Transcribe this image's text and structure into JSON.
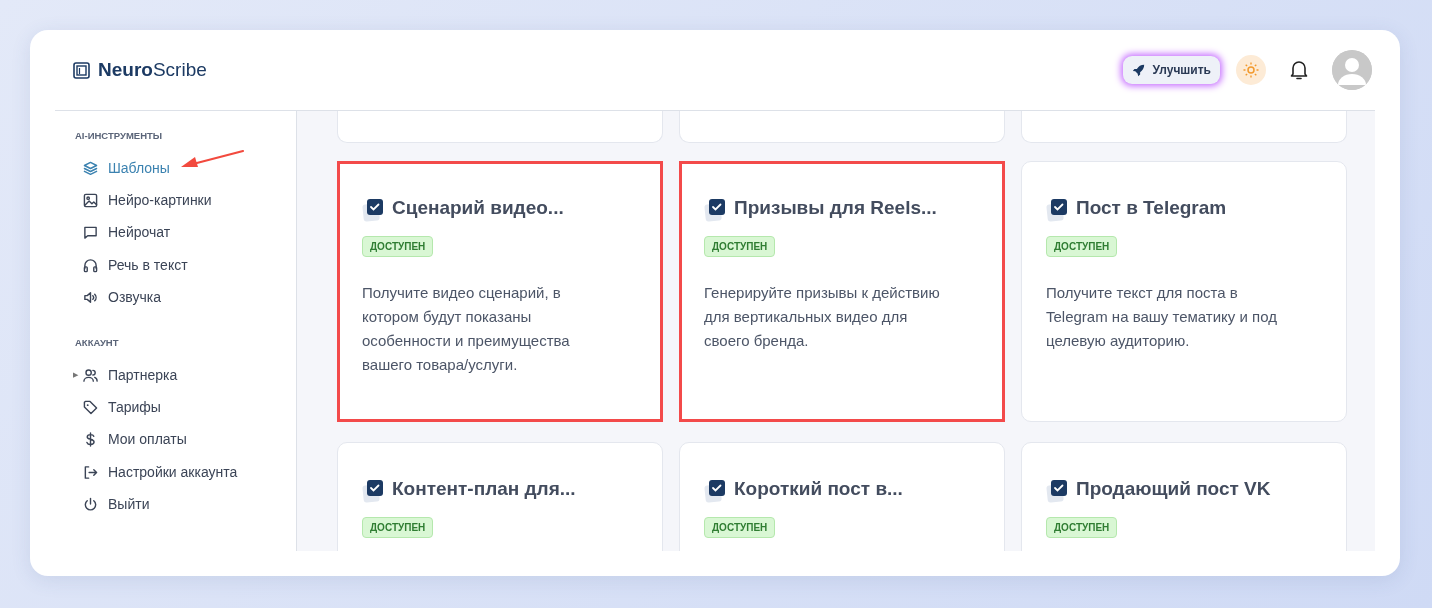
{
  "brand": {
    "bold": "Neuro",
    "light": "Scribe"
  },
  "header": {
    "upgrade_button": "Улучшить"
  },
  "sidebar": {
    "pointer_arrow": true,
    "sections": [
      {
        "title": "AI-ИНСТРУМЕНТЫ",
        "items": [
          {
            "label": "Шаблоны",
            "kind": "layers",
            "selected": true
          },
          {
            "label": "Нейро-картинки",
            "kind": "image",
            "selected": false
          },
          {
            "label": "Нейрочат",
            "kind": "chat",
            "selected": false
          },
          {
            "label": "Речь в текст",
            "kind": "headphones",
            "selected": false
          },
          {
            "label": "Озвучка",
            "kind": "speaker",
            "selected": false
          }
        ]
      },
      {
        "title": "АККАУНТ",
        "items": [
          {
            "label": "Партнерка",
            "kind": "users",
            "selected": false,
            "expand_marker": "▶"
          },
          {
            "label": "Тарифы",
            "kind": "tag",
            "selected": false
          },
          {
            "label": "Мои оплаты",
            "kind": "dollar",
            "selected": false
          },
          {
            "label": "Настройки аккаунта",
            "kind": "exit",
            "selected": false
          },
          {
            "label": "Выйти",
            "kind": "power",
            "selected": false
          }
        ]
      }
    ]
  },
  "cards": [
    {
      "title": "Сценарий видео...",
      "badge": "ДОСТУПЕН",
      "description": "Получите видео сценарий, в котором будут показаны особенности и преимущества вашего товара/услуги.",
      "highlighted": true
    },
    {
      "title": "Призывы для Reels...",
      "badge": "ДОСТУПЕН",
      "description": "Генерируйте призывы к действию для вертикальных видео для своего бренда.",
      "highlighted": true
    },
    {
      "title": "Пост в Telegram",
      "badge": "ДОСТУПЕН",
      "description": "Получите текст для поста в Telegram на вашу тематику и под целевую аудиторию.",
      "highlighted": false
    },
    {
      "title": "Контент-план для...",
      "badge": "ДОСТУПЕН",
      "highlighted": false
    },
    {
      "title": "Короткий пост в...",
      "badge": "ДОСТУПЕН",
      "highlighted": false
    },
    {
      "title": "Продающий пост VK",
      "badge": "ДОСТУПЕН",
      "highlighted": false
    }
  ]
}
